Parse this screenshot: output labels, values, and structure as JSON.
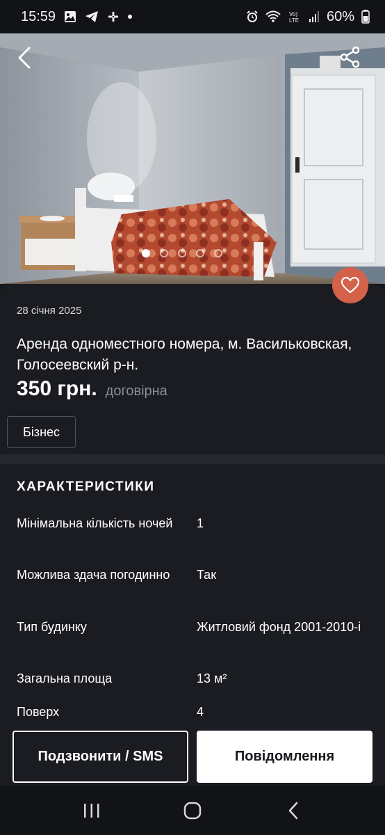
{
  "status_bar": {
    "time": "15:59",
    "battery": "60%",
    "icons": [
      "gallery-icon",
      "telegram-icon",
      "fan-icon",
      "dot-icon",
      "alarm-icon",
      "wifi-icon",
      "volte-icon",
      "signal-icon",
      "battery-icon"
    ]
  },
  "hero": {
    "image": "bedroom-photo",
    "pager_total": 5,
    "pager_active": 1
  },
  "listing": {
    "date": "28 січня 2025",
    "title": "Аренда одноместного номера, м. Васильковская, Голосеевский р-н.",
    "price": "350 грн.",
    "price_note": "договірна",
    "tag": "Бізнес"
  },
  "characteristics": {
    "heading": "ХАРАКТЕРИСТИКИ",
    "rows": [
      {
        "label": "Мінімальна кількість ночей",
        "value": "1"
      },
      {
        "label": "Можлива здача погодинно",
        "value": "Так"
      },
      {
        "label": "Тип будинку",
        "value": "Житловий фонд 2001-2010-і"
      },
      {
        "label": "Загальна площа",
        "value": "13 м²"
      },
      {
        "label": "Поверх",
        "value": "4"
      }
    ]
  },
  "actions": {
    "call_label": "Подзвонити / SMS",
    "message_label": "Повідомлення"
  },
  "colors": {
    "background": "#16181c",
    "card": "#1a1c21",
    "favorite": "#d4624a",
    "muted": "#8b8e94"
  }
}
